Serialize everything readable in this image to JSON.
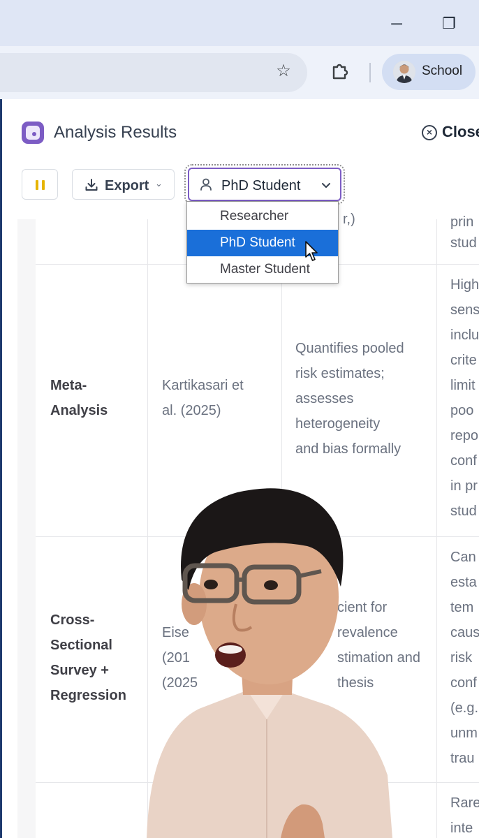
{
  "browser": {
    "window_controls": {
      "minimize": "─",
      "restore": "❐"
    },
    "toolbar": {
      "bookmark_icon": "star-icon",
      "extensions_icon": "puzzle-icon"
    },
    "profile": {
      "label": "School"
    }
  },
  "app": {
    "title": "Analysis Results",
    "close_label": "Close",
    "controls": {
      "export_label": "Export",
      "role_select": {
        "value": "PhD Student",
        "options": [
          "Researcher",
          "PhD Student",
          "Master Student"
        ],
        "highlighted": "PhD Student"
      }
    },
    "table": {
      "top_row_fragments": {
        "col3": "r,)",
        "col4_a": "prin",
        "col4_b": "stud"
      },
      "rows": [
        {
          "method": [
            "Meta-",
            "Analysis"
          ],
          "source": [
            "Kartikasari et",
            "al. (2025)"
          ],
          "strengths": [
            "Quantifies pooled",
            "risk estimates;",
            "assesses",
            "heterogeneity",
            "and bias formally"
          ],
          "limitations": [
            "High",
            "sens",
            "inclu",
            "crite",
            "limit",
            "poo",
            "repo",
            "conf",
            "in pr",
            "stud"
          ]
        },
        {
          "method": [
            "Cross-",
            "Sectional",
            "Survey +",
            "Regression"
          ],
          "source": [
            "Eise",
            "(201",
            "(2025"
          ],
          "strengths": [
            "cient for",
            "revalence",
            "stimation and",
            "thesis"
          ],
          "limitations": [
            "Can",
            "esta",
            "tem",
            "caus",
            "risk",
            "conf",
            "(e.g.",
            "unm",
            "trau"
          ]
        },
        {
          "limitations": [
            "Rare",
            "inte"
          ]
        }
      ]
    }
  },
  "colors": {
    "accent_purple": "#7c5cc4",
    "selected_option": "#1a6fd9",
    "pause_icon": "#e6b400",
    "titlebar": "#dfe6f5"
  }
}
